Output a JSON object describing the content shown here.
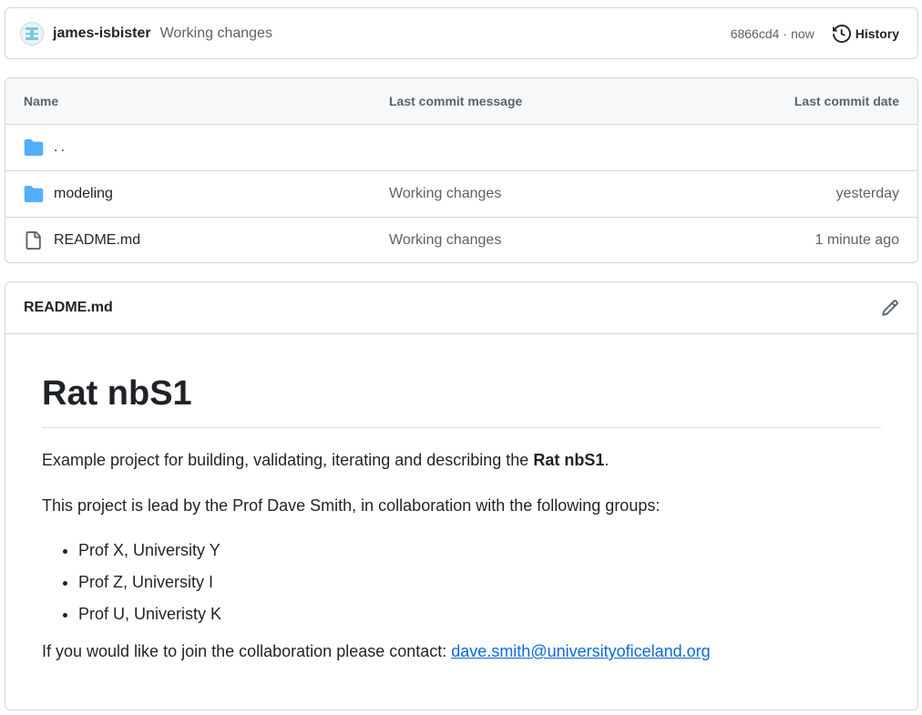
{
  "commit_bar": {
    "author": "james-isbister",
    "message": "Working changes",
    "sha": "6866cd4",
    "separator": "·",
    "time": "now",
    "history_label": "History"
  },
  "file_table": {
    "headers": {
      "name": "Name",
      "message": "Last commit message",
      "date": "Last commit date"
    },
    "rows": [
      {
        "name": "..",
        "message": "",
        "date": "",
        "icon": "folder-icon"
      },
      {
        "name": "modeling",
        "message": "Working changes",
        "date": "yesterday",
        "icon": "folder-icon"
      },
      {
        "name": "README.md",
        "message": "Working changes",
        "date": "1 minute ago",
        "icon": "file-icon"
      }
    ]
  },
  "readme": {
    "filename": "README.md",
    "heading": "Rat nbS1",
    "intro_prefix": "Example project for building, validating, iterating and describing the ",
    "intro_bold": "Rat nbS1",
    "intro_suffix": ".",
    "lead_text": "This project is lead by the Prof Dave Smith, in collaboration with the following groups:",
    "groups": [
      "Prof X, University Y",
      "Prof Z, University I",
      "Prof U, Univeristy K"
    ],
    "contact_prefix": "If you would like to join the collaboration please contact: ",
    "contact_email": "dave.smith@universityoficeland.org"
  },
  "colors": {
    "folder": "#54aeff",
    "link": "#0969da",
    "muted": "#59636e",
    "border": "#d0d7de"
  }
}
